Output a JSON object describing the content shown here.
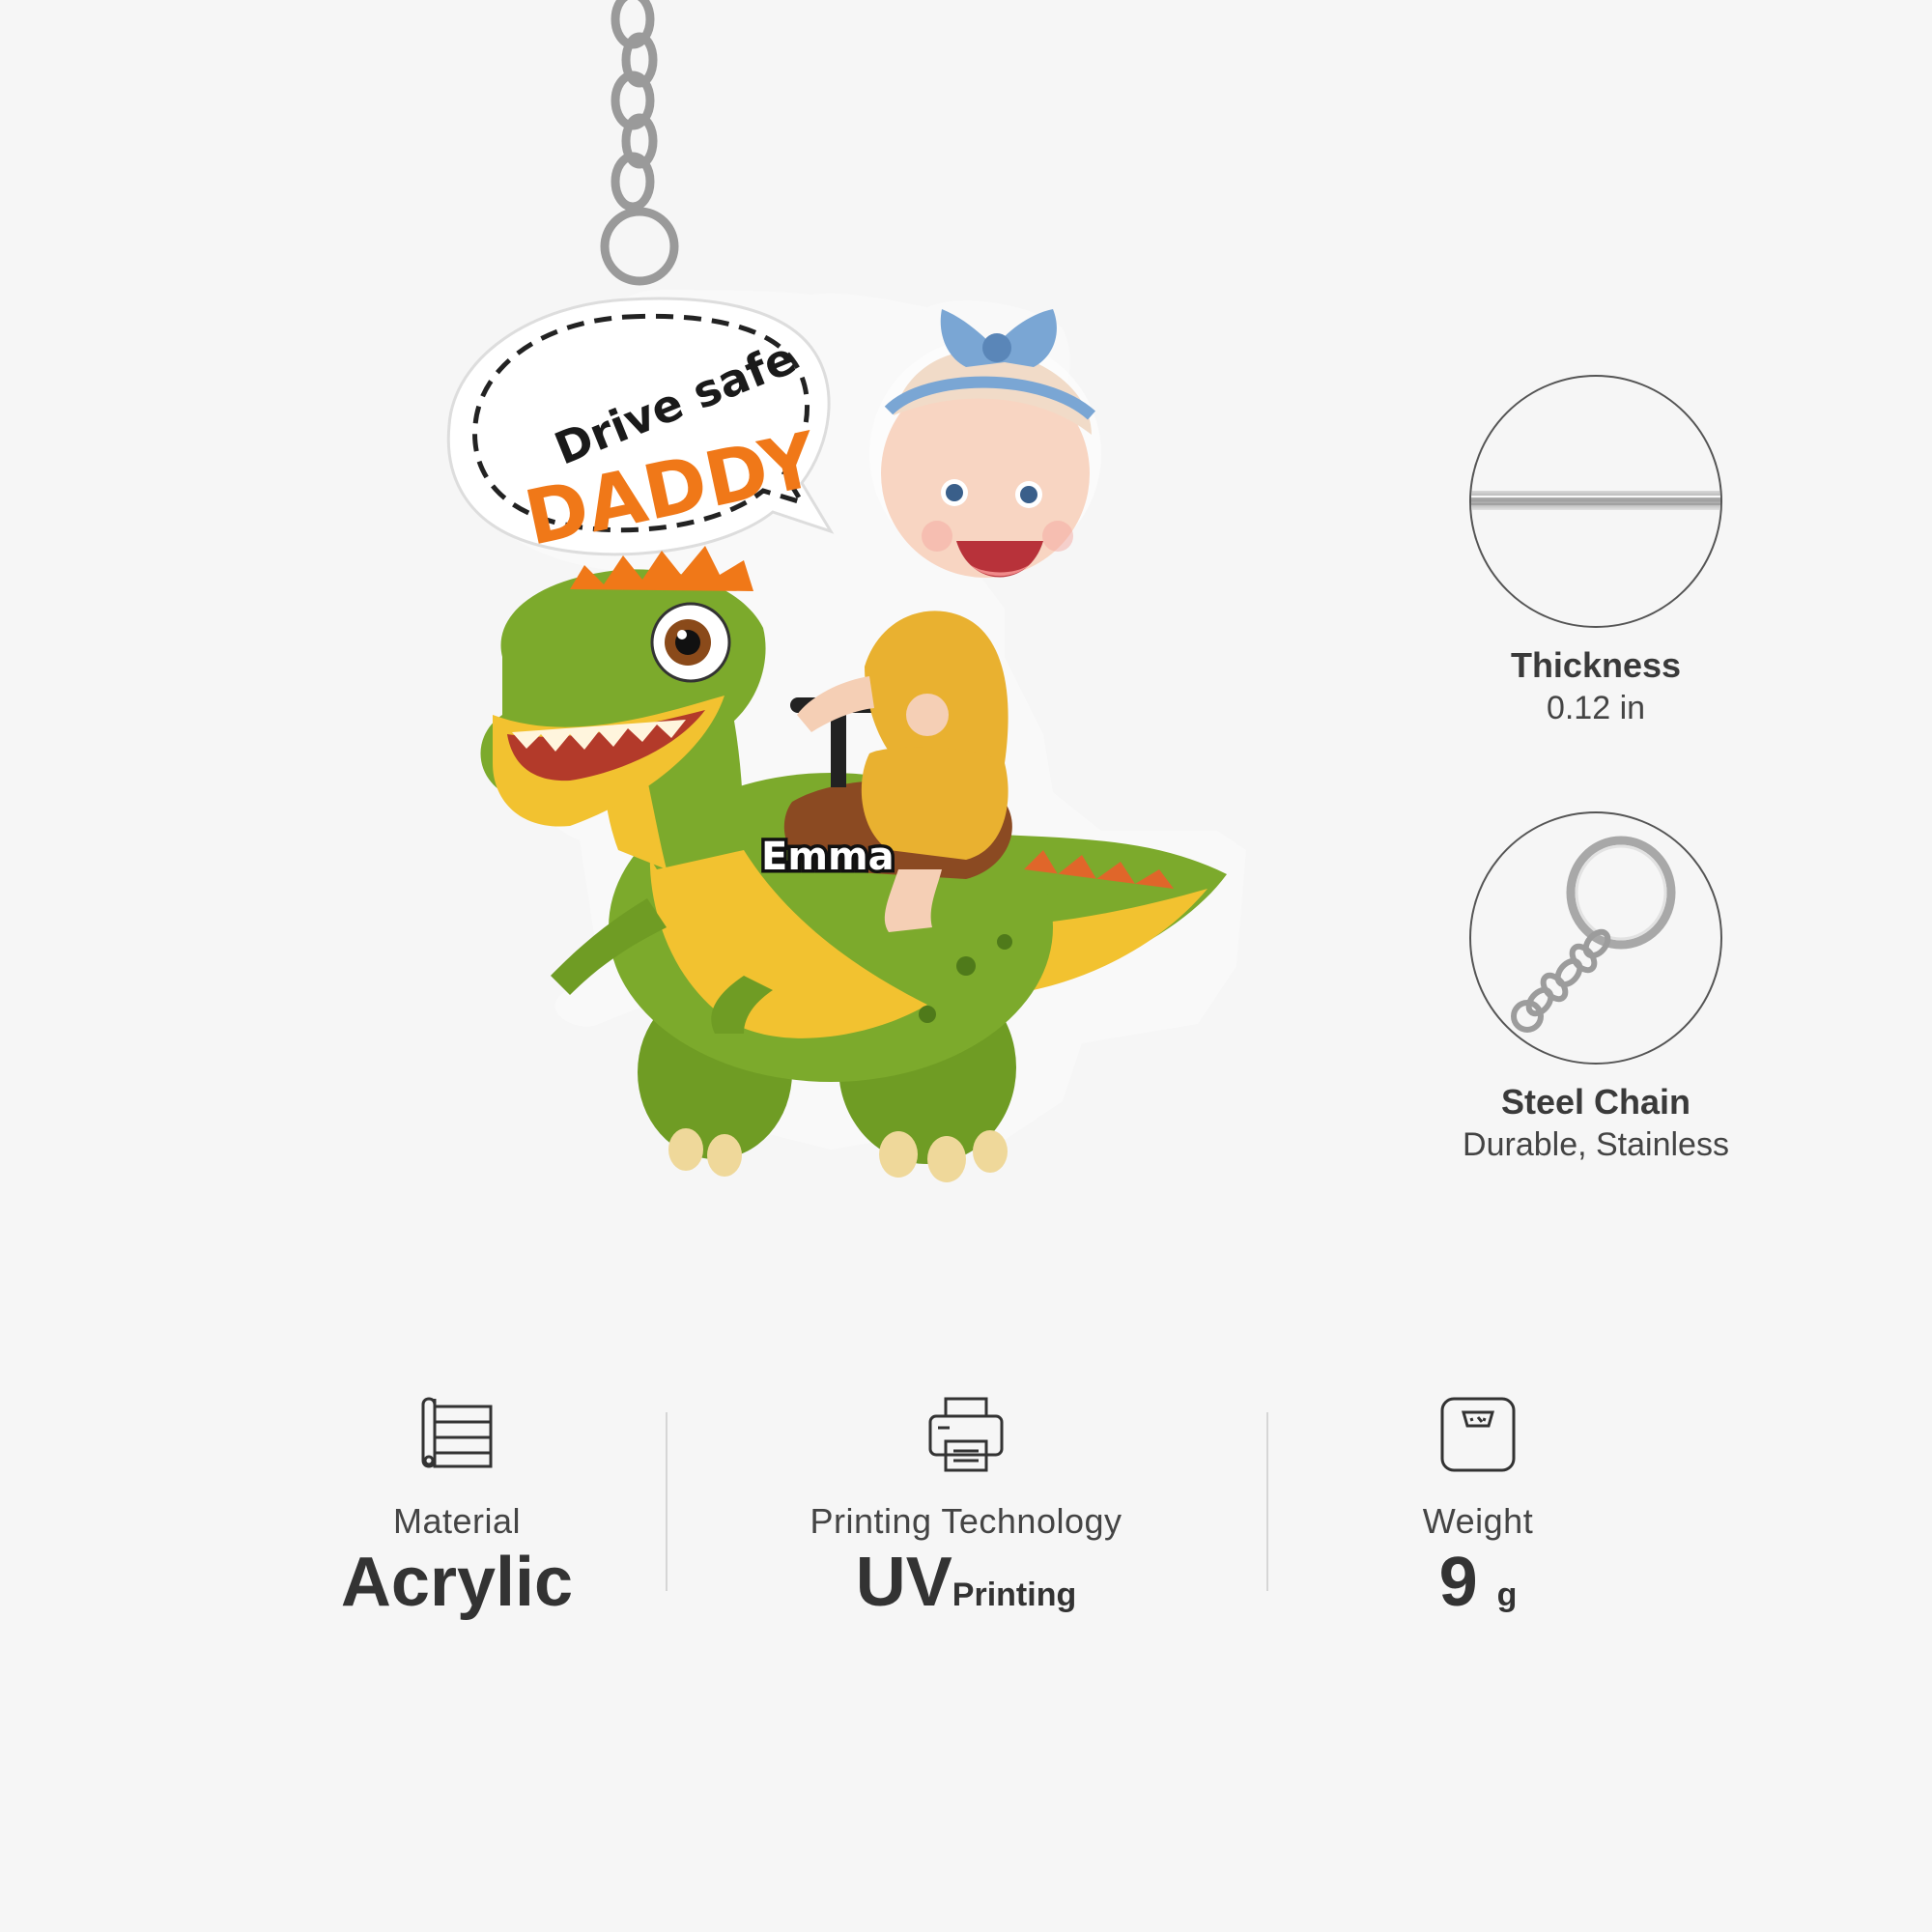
{
  "product": {
    "bubble_line1": "Drive safe",
    "bubble_line2": "DADDY",
    "name_tag": "Emma"
  },
  "specs": [
    {
      "title": "Thickness",
      "value": "0.12 in",
      "icon": "acrylic-edge-icon"
    },
    {
      "title": "Steel Chain",
      "value": "Durable, Stainless",
      "icon": "keyring-icon"
    }
  ],
  "features": {
    "material": {
      "label": "Material",
      "value": "Acrylic",
      "icon": "material-sheet-icon"
    },
    "printing": {
      "label": "Printing Technology",
      "value": "UV",
      "value_suffix": "Printing",
      "icon": "printer-icon"
    },
    "weight": {
      "label": "Weight",
      "value": "9",
      "unit": "g",
      "icon": "scale-icon"
    }
  },
  "colors": {
    "background": "#f6f6f6",
    "text": "#3a3a3a",
    "accent_orange": "#f07818",
    "dino_green": "#7caa2c",
    "dino_yellow": "#f2c230"
  }
}
